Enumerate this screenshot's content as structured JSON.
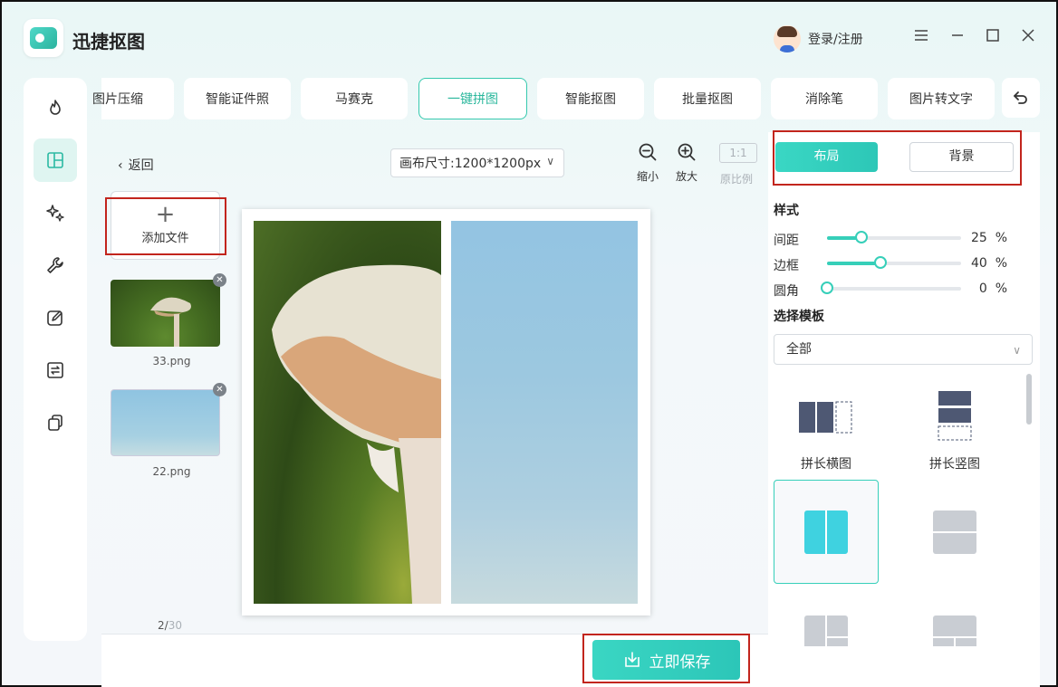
{
  "app": {
    "title": "迅捷抠图"
  },
  "header": {
    "login_label": "登录/注册",
    "window_controls": [
      "menu-icon",
      "minimize-icon",
      "maximize-icon",
      "close-icon"
    ]
  },
  "left_rail": {
    "items": [
      {
        "icon": "flame-icon"
      },
      {
        "icon": "collage-icon",
        "active": true
      },
      {
        "icon": "sparkle-icon"
      },
      {
        "icon": "wrench-icon"
      },
      {
        "icon": "edit-icon"
      },
      {
        "icon": "convert-icon"
      },
      {
        "icon": "copy-icon"
      }
    ]
  },
  "tabs": [
    {
      "label": "图片压缩"
    },
    {
      "label": "智能证件照"
    },
    {
      "label": "马赛克"
    },
    {
      "label": "一键拼图",
      "active": true
    },
    {
      "label": "智能抠图"
    },
    {
      "label": "批量抠图"
    },
    {
      "label": "消除笔"
    },
    {
      "label": "图片转文字"
    }
  ],
  "editor": {
    "back_label": "返回",
    "canvas_size_label": "画布尺寸:1200*1200px",
    "zoom_out_label": "缩小",
    "zoom_in_label": "放大",
    "ratio_box": "1:1",
    "ratio_label": "原比例"
  },
  "files": {
    "add_label": "添加文件",
    "items": [
      {
        "name": "33.png"
      },
      {
        "name": "22.png"
      }
    ],
    "pager_current": "2/",
    "pager_total": "30"
  },
  "save_label": "立即保存",
  "right_panel": {
    "layout_tab": "布局",
    "background_tab": "背景",
    "style_title": "样式",
    "sliders": [
      {
        "label": "间距",
        "value": 25,
        "unit": "%"
      },
      {
        "label": "边框",
        "value": 40,
        "unit": "%"
      },
      {
        "label": "圆角",
        "value": 0,
        "unit": "%"
      }
    ],
    "template_title": "选择模板",
    "template_filter": "全部",
    "templates": [
      {
        "name": "拼长横图"
      },
      {
        "name": "拼长竖图"
      },
      {
        "name": "",
        "selected": true
      },
      {
        "name": ""
      },
      {
        "name": ""
      },
      {
        "name": ""
      }
    ]
  },
  "colors": {
    "accent": "#36cfb9",
    "highlight": "#c2251d"
  }
}
